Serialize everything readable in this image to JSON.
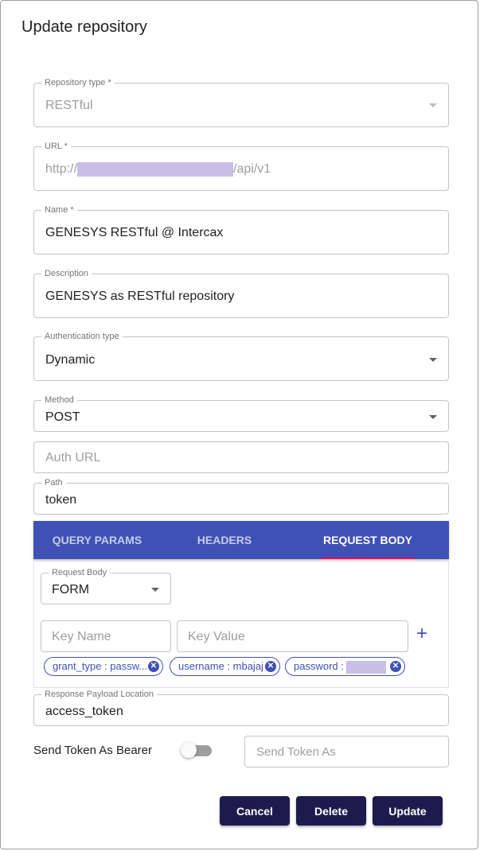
{
  "dialog": {
    "title": "Update repository"
  },
  "fields": {
    "repository_type": {
      "label": "Repository type *",
      "value": "RESTful"
    },
    "url": {
      "label": "URL *",
      "value_prefix": "http://",
      "value_suffix": "/api/v1"
    },
    "name": {
      "label": "Name *",
      "value": "GENESYS RESTful @ Intercax"
    },
    "description": {
      "label": "Description",
      "value": "GENESYS as RESTful repository"
    },
    "auth_type": {
      "label": "Authentication type",
      "value": "Dynamic"
    },
    "method": {
      "label": "Method",
      "value": "POST"
    },
    "auth_url": {
      "placeholder": "Auth URL"
    },
    "path": {
      "label": "Path",
      "value": "token"
    },
    "response_payload": {
      "label": "Response Payload Location",
      "value": "access_token"
    }
  },
  "tabs": [
    {
      "label": "QUERY PARAMS",
      "active": false
    },
    {
      "label": "HEADERS",
      "active": false
    },
    {
      "label": "REQUEST BODY",
      "active": true
    }
  ],
  "request_body": {
    "type_label": "Request Body",
    "type_value": "FORM",
    "key_name_placeholder": "Key Name",
    "key_value_placeholder": "Key Value",
    "add_icon": "plus-icon",
    "chips": [
      {
        "text": "grant_type : passw..."
      },
      {
        "text": "username : mbajaj"
      },
      {
        "text": "password : "
      }
    ]
  },
  "bearer": {
    "label": "Send Token As Bearer",
    "toggle_on": false,
    "send_as_placeholder": "Send Token As"
  },
  "buttons": {
    "cancel": "Cancel",
    "delete": "Delete",
    "update": "Update"
  },
  "colors": {
    "tab_bg": "#3f51b5",
    "tab_indicator": "#f50057",
    "button_bg": "#1f1a4e",
    "redaction": "#c8bee6"
  }
}
